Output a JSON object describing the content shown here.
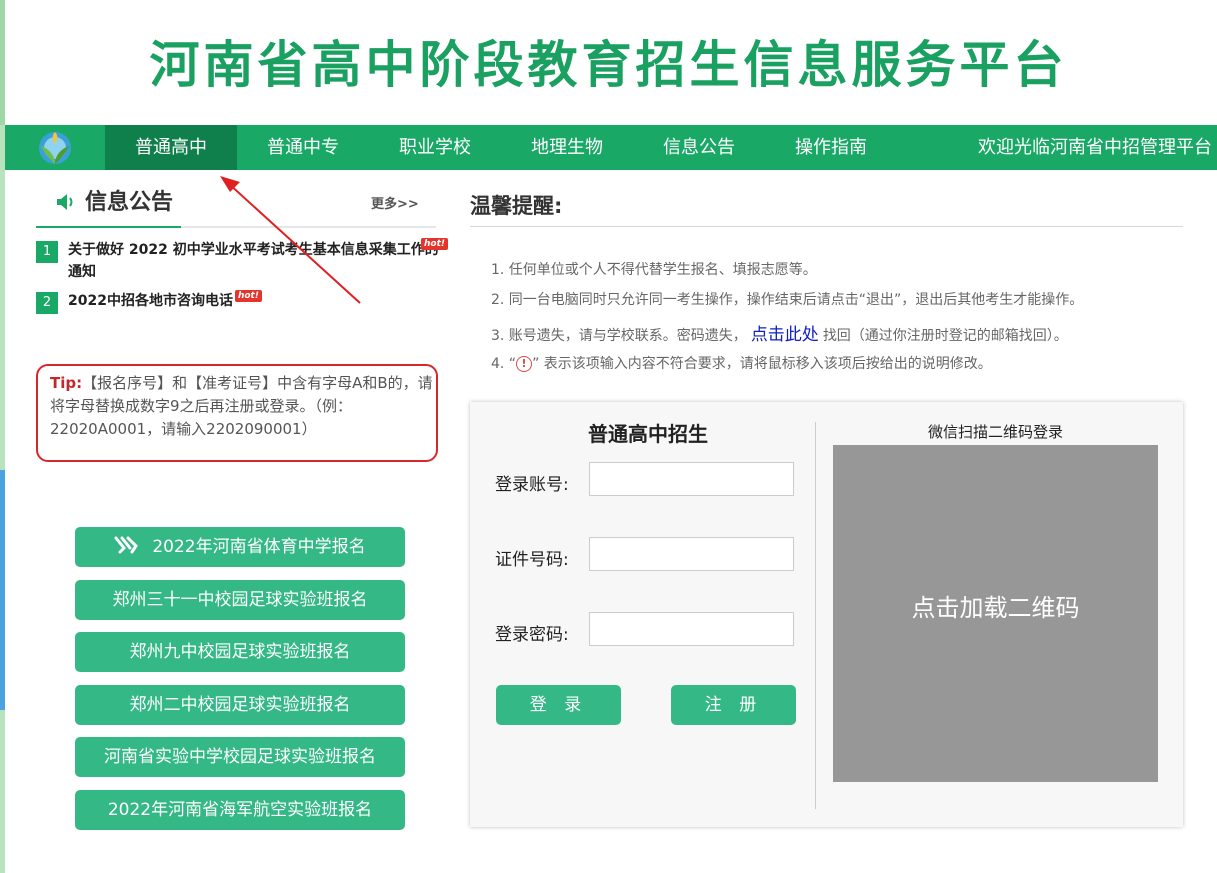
{
  "site": {
    "title": "河南省高中阶段教育招生信息服务平台"
  },
  "nav": {
    "items": [
      "普通高中",
      "普通中专",
      "职业学校",
      "地理生物",
      "信息公告",
      "操作指南"
    ],
    "active": "普通高中",
    "welcome": "欢迎光临河南省中招管理平台",
    "logo_icon": "leaf-logo-icon"
  },
  "notices": {
    "title": "信息公告",
    "more": "更多>>",
    "hot_label": "hot!",
    "items": [
      {
        "num": "1",
        "text": "关于做好 2022 初中学业水平考试考生基本信息采集工作的通知"
      },
      {
        "num": "2",
        "text": "2022中招各地市咨询电话"
      }
    ]
  },
  "tip": {
    "label": "Tip:",
    "text": "【报名序号】和【准考证号】中含有字母A和B的，请将字母替换成数字9之后再注册或登录。（例：22020A0001，请输入2202090001）"
  },
  "special_links": [
    "2022年河南省体育中学报名",
    "郑州三十一中校园足球实验班报名",
    "郑州九中校园足球实验班报名",
    "郑州二中校园足球实验班报名",
    "河南省实验中学校园足球实验班报名",
    "2022年河南省海军航空实验班报名"
  ],
  "reminder": {
    "title": "温馨提醒:",
    "items": {
      "r1": "1. 任何单位或个人不得代替学生报名、填报志愿等。",
      "r2": "2. 同一台电脑同时只允许同一考生操作，操作结束后请点击“退出”，退出后其他考生才能操作。",
      "r3_pre": "3. 账号遗失，请与学校联系。密码遗失，",
      "r3_link": "点击此处",
      "r3_post": "找回（通过你注册时登记的邮箱找回）。",
      "r4_pre": "4. “",
      "r4_icon": "!",
      "r4_post": "” 表示该项输入内容不符合要求，请将鼠标移入该项后按给出的说明修改。"
    }
  },
  "login": {
    "title": "普通高中招生",
    "account_label": "登录账号:",
    "id_label": "证件号码:",
    "password_label": "登录密码:",
    "account_value": "",
    "id_value": "",
    "password_value": "",
    "login_button": "登 录",
    "register_button": "注 册"
  },
  "qr": {
    "title": "微信扫描二维码登录",
    "placeholder": "点击加载二维码"
  },
  "colors": {
    "brand_green": "#1aa867",
    "active_nav": "#0f7f4b",
    "button_green": "#34b886",
    "tip_border": "#d9262c"
  }
}
